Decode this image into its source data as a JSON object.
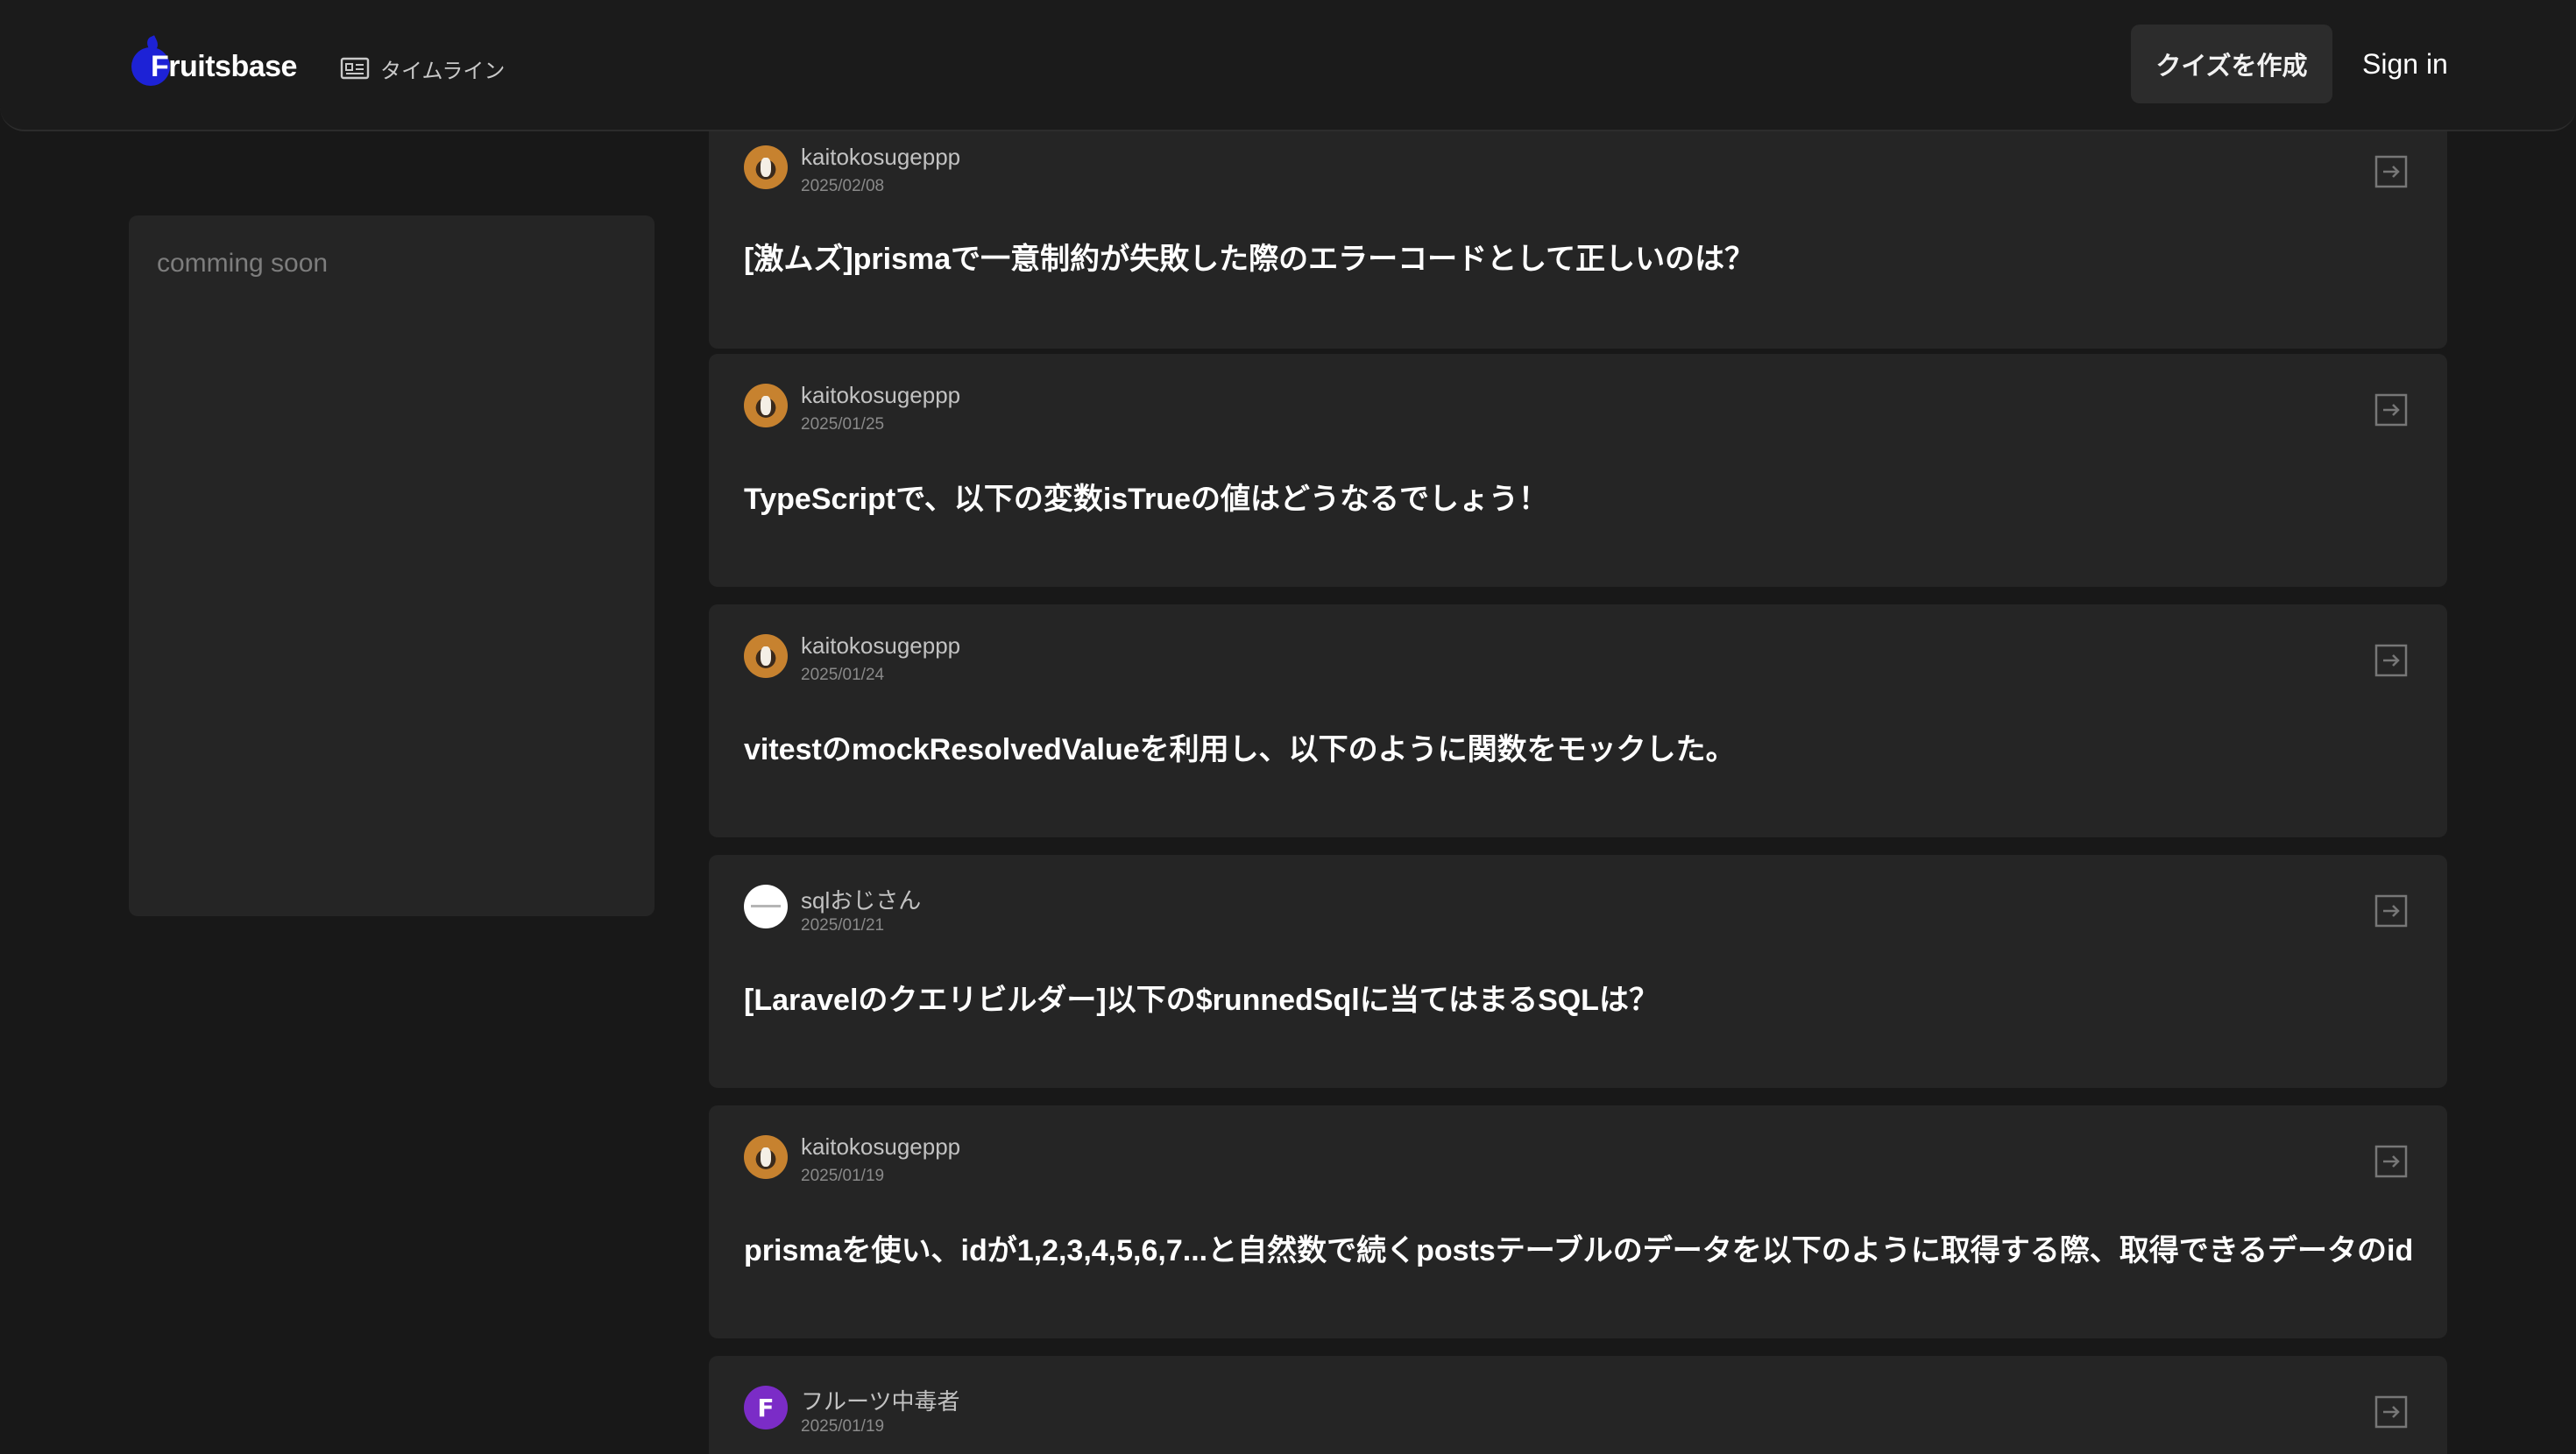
{
  "header": {
    "logo_text": "Fruitsbase",
    "nav_timeline_label": "タイムライン",
    "create_quiz_label": "クイズを作成",
    "sign_in_label": "Sign in"
  },
  "sidebar": {
    "placeholder_text": "comming soon"
  },
  "posts": [
    {
      "username": "kaitokosugeppp",
      "date": "2025/02/08",
      "title": "[激ムズ]prismaで一意制約が失敗した際のエラーコードとして正しいのは？",
      "avatar": "penguin"
    },
    {
      "username": "kaitokosugeppp",
      "date": "2025/01/25",
      "title": "TypeScriptで、以下の変数isTrueの値はどうなるでしょう！",
      "avatar": "penguin"
    },
    {
      "username": "kaitokosugeppp",
      "date": "2025/01/24",
      "title": "vitestのmockResolvedValueを利用し、以下のように関数をモックした。",
      "avatar": "penguin"
    },
    {
      "username": "sqlおじさん",
      "date": "2025/01/21",
      "title": "[Laravelのクエリビルダー]以下の$runnedSqlに当てはまるSQLは？",
      "avatar": "white"
    },
    {
      "username": "kaitokosugeppp",
      "date": "2025/01/19",
      "title": "prismaを使い、idが1,2,3,4,5,6,7...と自然数で続くpostsテーブルのデータを以下のように取得する際、取得できるデータのid",
      "avatar": "penguin"
    },
    {
      "username": "フルーツ中毒者",
      "date": "2025/01/19",
      "title": "",
      "avatar": "fruit",
      "avatar_letter": "F"
    }
  ],
  "colors": {
    "logo_accent": "#1d22d6",
    "fruit_avatar": "#7b2cc7"
  }
}
